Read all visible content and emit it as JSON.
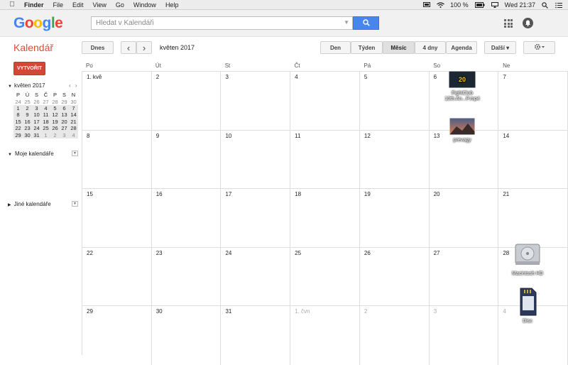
{
  "menubar": {
    "app": "Finder",
    "items": [
      "File",
      "Edit",
      "View",
      "Go",
      "Window",
      "Help"
    ],
    "battery": "100 %",
    "time": "Wed 21:37"
  },
  "header": {
    "logo_letters": [
      "G",
      "o",
      "o",
      "g",
      "l",
      "e"
    ],
    "search_placeholder": "Hledat v Kalendáři"
  },
  "toolbar": {
    "title": "Kalendář",
    "today": "Dnes",
    "prev": "‹",
    "next": "›",
    "period": "květen 2017",
    "views": [
      "Den",
      "Týden",
      "Měsíc",
      "4 dny",
      "Agenda"
    ],
    "active_view": "Měsíc",
    "more": "Další ▾",
    "settings_icon": "gear-icon"
  },
  "sidebar": {
    "create": "VYTVOŘIT",
    "mini_title": "květen 2017",
    "mini_prev": "‹",
    "mini_next": "›",
    "mini_dow": [
      "P",
      "Ú",
      "S",
      "Č",
      "P",
      "S",
      "N"
    ],
    "mini_weeks": [
      [
        "24",
        "25",
        "26",
        "27",
        "28",
        "29",
        "30"
      ],
      [
        "1",
        "2",
        "3",
        "4",
        "5",
        "6",
        "7"
      ],
      [
        "8",
        "9",
        "10",
        "11",
        "12",
        "13",
        "14"
      ],
      [
        "15",
        "16",
        "17",
        "18",
        "19",
        "20",
        "21"
      ],
      [
        "22",
        "23",
        "24",
        "25",
        "26",
        "27",
        "28"
      ],
      [
        "29",
        "30",
        "31",
        "1",
        "2",
        "3",
        "4"
      ]
    ],
    "my_calendars": "Moje kalendáře",
    "other_calendars": "Jiné kalendáře"
  },
  "month": {
    "dow": [
      "Po",
      "Út",
      "St",
      "Čt",
      "Pá",
      "So",
      "Ne"
    ],
    "weeks": [
      [
        "1. kvě",
        "2",
        "3",
        "4",
        "5",
        "6",
        "7"
      ],
      [
        "8",
        "9",
        "10",
        "11",
        "12",
        "13",
        "14"
      ],
      [
        "15",
        "16",
        "17",
        "18",
        "19",
        "20",
        "21"
      ],
      [
        "22",
        "23",
        "24",
        "25",
        "26",
        "27",
        "28"
      ],
      [
        "29",
        "30",
        "31",
        "1. čvn",
        "2",
        "3",
        "4"
      ]
    ]
  },
  "desktop": {
    "video_label_1": "FightClub",
    "video_label_2": "10th.An...P.mp4",
    "image_label": "prevagy",
    "hdd_label": "Macintosh HD",
    "sd_label": "Disc"
  }
}
